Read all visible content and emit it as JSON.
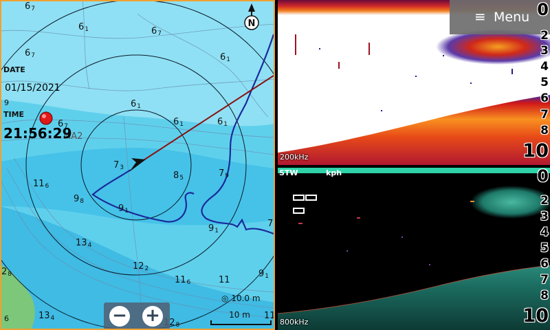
{
  "chart": {
    "date_label": "DATE",
    "date_value": "01/15/2021",
    "time_label": "TIME",
    "time_value": "21:56:29",
    "waypoint_name": "MA2",
    "compass_letter": "N",
    "range_text": "10.0 m",
    "scale_text": "10 m",
    "zoom_out_label": "−",
    "zoom_in_label": "+",
    "depths": [
      {
        "main": "6",
        "sub": "7"
      },
      {
        "main": "6",
        "sub": "1"
      },
      {
        "main": "6",
        "sub": "7"
      },
      {
        "main": "6",
        "sub": "7"
      },
      {
        "main": "6",
        "sub": "1"
      },
      {
        "main": "9",
        "sub": ""
      },
      {
        "main": "6",
        "sub": "7"
      },
      {
        "main": "6",
        "sub": "1"
      },
      {
        "main": "6",
        "sub": "1"
      },
      {
        "main": "6",
        "sub": "1"
      },
      {
        "main": "7",
        "sub": "3"
      },
      {
        "main": "8",
        "sub": "5"
      },
      {
        "main": "7",
        "sub": "9"
      },
      {
        "main": "11",
        "sub": "6"
      },
      {
        "main": "9",
        "sub": "8"
      },
      {
        "main": "9",
        "sub": "1"
      },
      {
        "main": "9",
        "sub": "1"
      },
      {
        "main": "7",
        "sub": ""
      },
      {
        "main": "13",
        "sub": "4"
      },
      {
        "main": "12",
        "sub": "2"
      },
      {
        "main": "2",
        "sub": "8"
      },
      {
        "main": "11",
        "sub": "6"
      },
      {
        "main": "11",
        "sub": ""
      },
      {
        "main": "9",
        "sub": "1"
      },
      {
        "main": "6",
        "sub": ""
      },
      {
        "main": "13",
        "sub": "4"
      },
      {
        "main": "12",
        "sub": "8"
      },
      {
        "main": "11",
        "sub": ""
      }
    ],
    "colors": {
      "water": "#5fd0ec",
      "shallow": "#a8e8f8",
      "deep": "#3ab4e0",
      "land": "#7cc77a",
      "track": "#1a2a9a",
      "heading": "#8a1010",
      "active_border": "#f0a030"
    }
  },
  "menu": {
    "icon": "menu-icon",
    "label": "Menu"
  },
  "sonar_top": {
    "frequency": "200kHz",
    "scale": [
      "0",
      "2",
      "3",
      "4",
      "5",
      "6",
      "7",
      "8",
      "10"
    ]
  },
  "sonar_bottom": {
    "stw_label": "STW",
    "speed_unit": "kph",
    "frequency": "800kHz",
    "scale": [
      "0",
      "2",
      "3",
      "4",
      "5",
      "6",
      "7",
      "8",
      "10"
    ]
  }
}
